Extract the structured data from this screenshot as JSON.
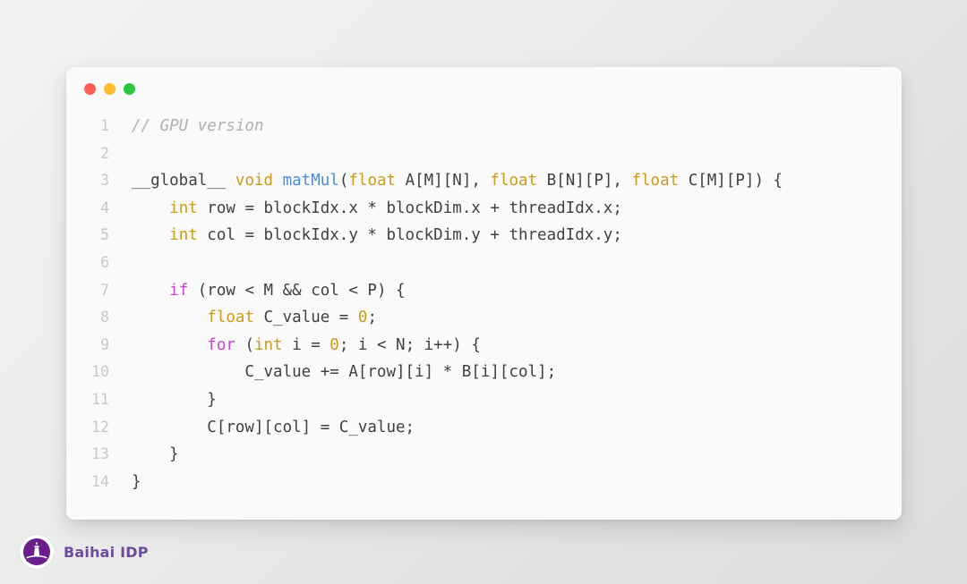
{
  "window": {
    "dots": [
      {
        "name": "close-dot",
        "color": "#ff5f56"
      },
      {
        "name": "minimize-dot",
        "color": "#febc2e"
      },
      {
        "name": "maximize-dot",
        "color": "#29c840"
      }
    ]
  },
  "editor": {
    "language": "cuda-c",
    "lines": [
      {
        "no": "1",
        "tokens": [
          {
            "t": "// GPU version",
            "c": "comment"
          }
        ]
      },
      {
        "no": "2",
        "tokens": []
      },
      {
        "no": "3",
        "tokens": [
          {
            "t": "__global__ ",
            "c": "plain"
          },
          {
            "t": "void",
            "c": "type"
          },
          {
            "t": " ",
            "c": "plain"
          },
          {
            "t": "matMul",
            "c": "fn"
          },
          {
            "t": "(",
            "c": "plain"
          },
          {
            "t": "float",
            "c": "type"
          },
          {
            "t": " A[M][N], ",
            "c": "plain"
          },
          {
            "t": "float",
            "c": "type"
          },
          {
            "t": " B[N][P], ",
            "c": "plain"
          },
          {
            "t": "float",
            "c": "type"
          },
          {
            "t": " C[M][P]) {",
            "c": "plain"
          }
        ]
      },
      {
        "no": "4",
        "tokens": [
          {
            "t": "    ",
            "c": "plain"
          },
          {
            "t": "int",
            "c": "type"
          },
          {
            "t": " row = blockIdx.x * blockDim.x + threadIdx.x;",
            "c": "plain"
          }
        ]
      },
      {
        "no": "5",
        "tokens": [
          {
            "t": "    ",
            "c": "plain"
          },
          {
            "t": "int",
            "c": "type"
          },
          {
            "t": " col = blockIdx.y * blockDim.y + threadIdx.y;",
            "c": "plain"
          }
        ]
      },
      {
        "no": "6",
        "tokens": []
      },
      {
        "no": "7",
        "tokens": [
          {
            "t": "    ",
            "c": "plain"
          },
          {
            "t": "if",
            "c": "kw"
          },
          {
            "t": " (row < M && col < P) {",
            "c": "plain"
          }
        ]
      },
      {
        "no": "8",
        "tokens": [
          {
            "t": "        ",
            "c": "plain"
          },
          {
            "t": "float",
            "c": "type"
          },
          {
            "t": " C_value = ",
            "c": "plain"
          },
          {
            "t": "0",
            "c": "num"
          },
          {
            "t": ";",
            "c": "plain"
          }
        ]
      },
      {
        "no": "9",
        "tokens": [
          {
            "t": "        ",
            "c": "plain"
          },
          {
            "t": "for",
            "c": "kw"
          },
          {
            "t": " (",
            "c": "plain"
          },
          {
            "t": "int",
            "c": "type"
          },
          {
            "t": " i = ",
            "c": "plain"
          },
          {
            "t": "0",
            "c": "num"
          },
          {
            "t": "; i < N; i++) {",
            "c": "plain"
          }
        ]
      },
      {
        "no": "10",
        "tokens": [
          {
            "t": "            C_value += A[row][i] * B[i][col];",
            "c": "plain"
          }
        ]
      },
      {
        "no": "11",
        "tokens": [
          {
            "t": "        }",
            "c": "plain"
          }
        ]
      },
      {
        "no": "12",
        "tokens": [
          {
            "t": "        C[row][col] = C_value;",
            "c": "plain"
          }
        ]
      },
      {
        "no": "13",
        "tokens": [
          {
            "t": "    }",
            "c": "plain"
          }
        ]
      },
      {
        "no": "14",
        "tokens": [
          {
            "t": "}",
            "c": "plain"
          }
        ]
      }
    ]
  },
  "brand": {
    "name": "Baihai IDP",
    "logo_icon": "lighthouse-icon",
    "logo_color": "#6b1f8a",
    "text_color": "#6d4c9f"
  }
}
